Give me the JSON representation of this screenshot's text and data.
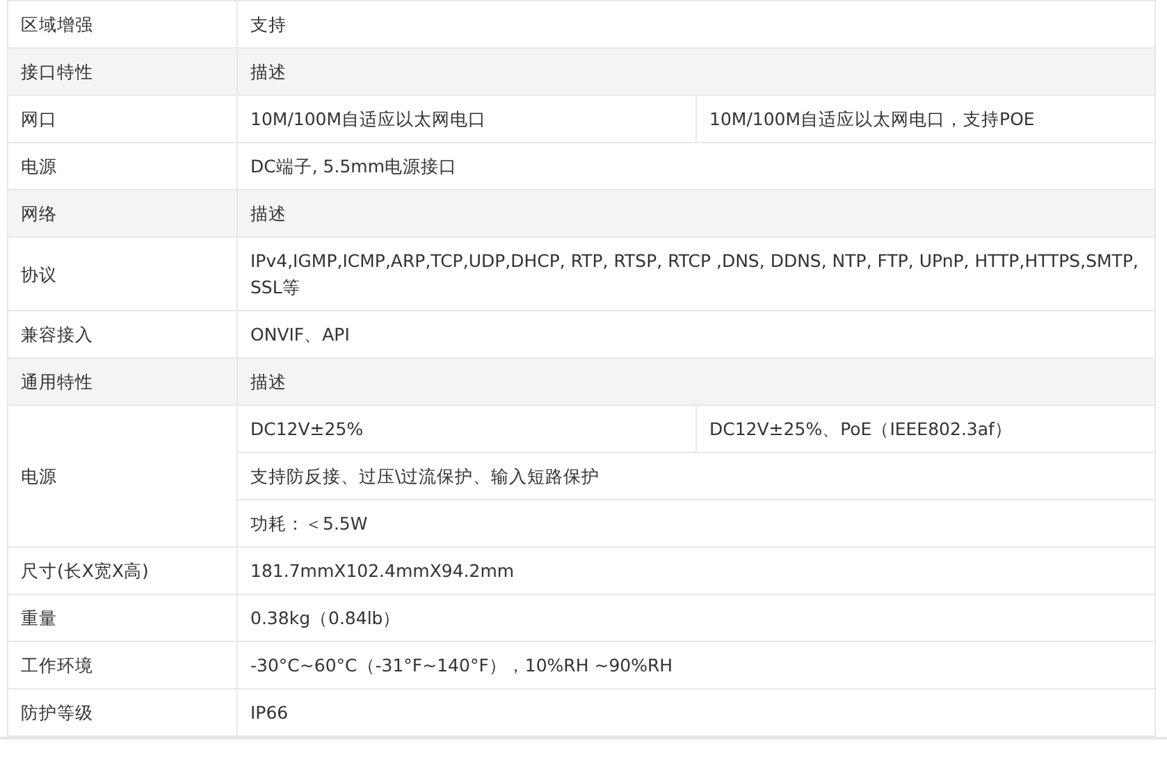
{
  "table": {
    "rows": [
      {
        "kind": "spec",
        "label": "区域增强",
        "lines": [
          [
            "支持"
          ]
        ]
      },
      {
        "kind": "section",
        "label": "接口特性",
        "lines": [
          [
            "描述"
          ]
        ]
      },
      {
        "kind": "spec",
        "label": "网口",
        "lines": [
          [
            "10M/100M自适应以太网电口",
            "10M/100M自适应以太网电口，支持POE"
          ]
        ]
      },
      {
        "kind": "spec",
        "label": "电源",
        "lines": [
          [
            "DC端子, 5.5mm电源接口"
          ]
        ]
      },
      {
        "kind": "section",
        "label": "网络",
        "lines": [
          [
            "描述"
          ]
        ]
      },
      {
        "kind": "spec",
        "label": "协议",
        "lines": [
          [
            "IPv4,IGMP,ICMP,ARP,TCP,UDP,DHCP, RTP, RTSP, RTCP ,DNS, DDNS, NTP, FTP, UPnP, HTTP,HTTPS,SMTP, SSL等"
          ]
        ]
      },
      {
        "kind": "spec",
        "label": "兼容接入",
        "lines": [
          [
            "ONVIF、API"
          ]
        ]
      },
      {
        "kind": "section",
        "label": "通用特性",
        "lines": [
          [
            "描述"
          ]
        ]
      },
      {
        "kind": "spec",
        "label": "电源",
        "lines": [
          [
            "DC12V±25%",
            "DC12V±25%、PoE（IEEE802.3af）"
          ],
          [
            "支持防反接、过压\\过流保护、输入短路保护"
          ],
          [
            "功耗：＜5.5W"
          ]
        ]
      },
      {
        "kind": "spec",
        "label": "尺寸(长X宽X高)",
        "lines": [
          [
            "181.7mmX102.4mmX94.2mm"
          ]
        ]
      },
      {
        "kind": "spec",
        "label": "重量",
        "lines": [
          [
            "0.38kg（0.84lb）"
          ]
        ]
      },
      {
        "kind": "spec",
        "label": "工作环境",
        "lines": [
          [
            "-30°C~60°C（-31°F~140°F），10%RH ~90%RH"
          ]
        ]
      },
      {
        "kind": "spec",
        "label": "防护等级",
        "lines": [
          [
            "IP66"
          ]
        ]
      }
    ]
  }
}
